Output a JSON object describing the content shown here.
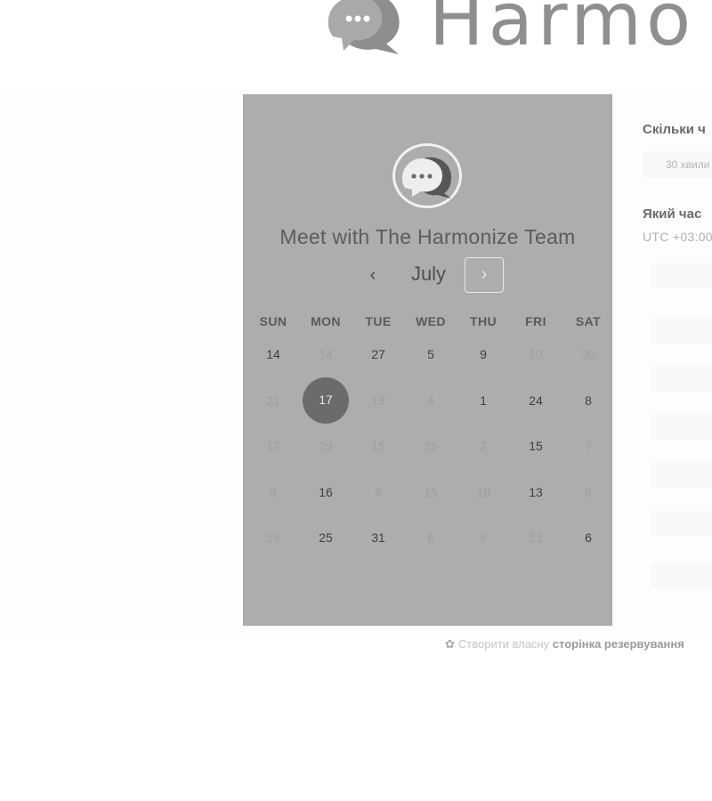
{
  "header": {
    "brand_name": "Harmo"
  },
  "calendar": {
    "title": "Meet with The Harmonize Team",
    "month": "July",
    "prev_icon": "chevron-left-icon",
    "next_icon": "chevron-right-icon",
    "weekdays": [
      "SUN",
      "MON",
      "TUE",
      "WED",
      "THU",
      "FRI",
      "SAT"
    ],
    "weeks": [
      [
        {
          "d": "14",
          "s": "avail"
        },
        {
          "d": "14",
          "s": "dim"
        },
        {
          "d": "27",
          "s": "avail"
        },
        {
          "d": "5",
          "s": "avail"
        },
        {
          "d": "9",
          "s": "avail"
        },
        {
          "d": "10",
          "s": "dim"
        },
        {
          "d": "30",
          "s": "dim"
        }
      ],
      [
        {
          "d": "21",
          "s": "dim"
        },
        {
          "d": "17",
          "s": "selected"
        },
        {
          "d": "18",
          "s": "dim"
        },
        {
          "d": "4",
          "s": "dim"
        },
        {
          "d": "1",
          "s": "avail"
        },
        {
          "d": "24",
          "s": "avail"
        },
        {
          "d": "8",
          "s": "avail"
        }
      ],
      [
        {
          "d": "17",
          "s": "dim"
        },
        {
          "d": "29",
          "s": "dim"
        },
        {
          "d": "15",
          "s": "dim"
        },
        {
          "d": "26",
          "s": "dim"
        },
        {
          "d": "2",
          "s": "dim"
        },
        {
          "d": "15",
          "s": "avail"
        },
        {
          "d": "7",
          "s": "dim"
        }
      ],
      [
        {
          "d": "9",
          "s": "dim"
        },
        {
          "d": "16",
          "s": "avail"
        },
        {
          "d": "6",
          "s": "dim"
        },
        {
          "d": "15",
          "s": "dim"
        },
        {
          "d": "18",
          "s": "dim"
        },
        {
          "d": "13",
          "s": "avail"
        },
        {
          "d": "6",
          "s": "dim"
        }
      ],
      [
        {
          "d": "19",
          "s": "dim"
        },
        {
          "d": "25",
          "s": "avail"
        },
        {
          "d": "31",
          "s": "avail"
        },
        {
          "d": "6",
          "s": "dim"
        },
        {
          "d": "8",
          "s": "dim"
        },
        {
          "d": "21",
          "s": "dim"
        },
        {
          "d": "6",
          "s": "avail"
        }
      ]
    ]
  },
  "side": {
    "duration_label": "Скільки ч",
    "duration_value": "30 хвили",
    "time_label": "Який час",
    "timezone": "UTC +03:00"
  },
  "footer": {
    "prefix": "Створити власну",
    "bold": "сторінка резервування"
  },
  "colors": {
    "panel_bg": "#adadad",
    "selected_day": "#6b6b6b",
    "brand_text": "#8f8f8f"
  }
}
